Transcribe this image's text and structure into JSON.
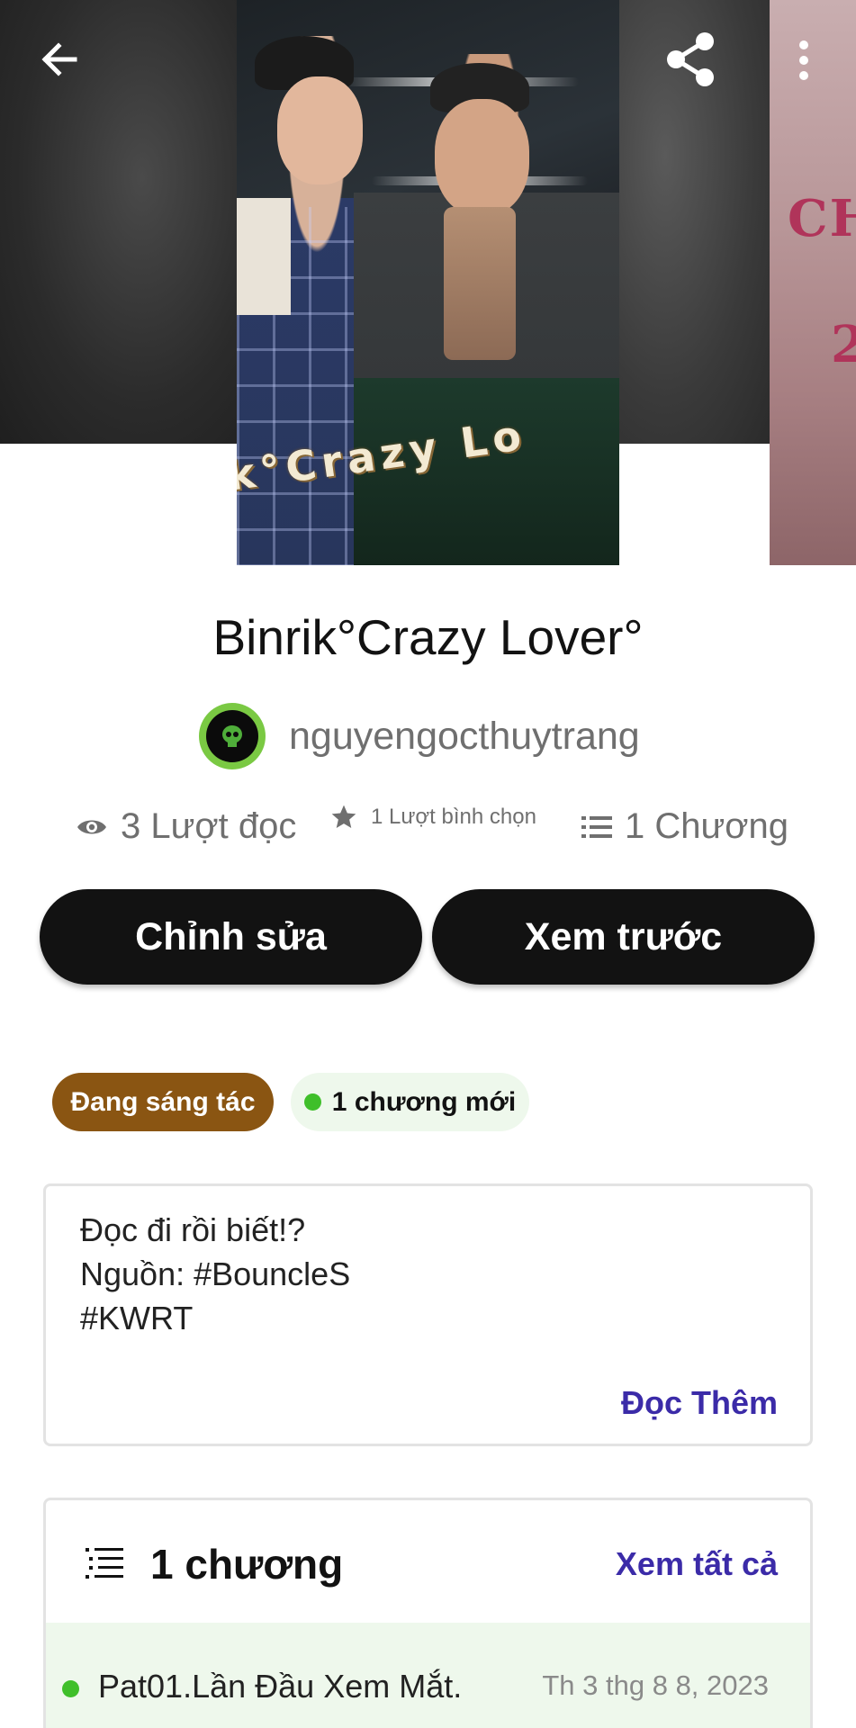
{
  "story": {
    "title": "Binrik°Crazy Lover°",
    "author": "nguyengocthuytrang",
    "cover_text": "k°Crazy Lo"
  },
  "side_cover": {
    "line1": "CH",
    "line2": "2"
  },
  "stats": {
    "reads": "3 Lượt đọc",
    "votes": "1 Lượt bình chọn",
    "parts": "1 Chương"
  },
  "actions": {
    "edit": "Chỉnh sửa",
    "preview": "Xem trước"
  },
  "tags": {
    "status": "Đang sáng tác",
    "new_chapters": "1 chương mới"
  },
  "description": {
    "lines": [
      "Đọc đi rồi biết!?",
      "Nguồn: #BouncleS",
      "#KWRT"
    ],
    "read_more": "Đọc Thêm"
  },
  "chapters": {
    "count_label": "1 chương",
    "view_all": "Xem tất cả",
    "items": [
      {
        "title": "Pat01.Lần Đầu Xem Mắt.",
        "date": "Th 3 thg 8 8, 2023"
      }
    ]
  },
  "colors": {
    "status_tag": "#8a5512",
    "new_tag_bg": "#eef8ec",
    "new_dot": "#3fbf2a",
    "link": "#3b2ba8",
    "button": "#121212"
  },
  "icons": {
    "back": "arrow-left-icon",
    "share": "share-icon",
    "more": "more-vertical-icon",
    "reads": "eye-icon",
    "votes": "star-icon",
    "parts": "list-icon"
  }
}
